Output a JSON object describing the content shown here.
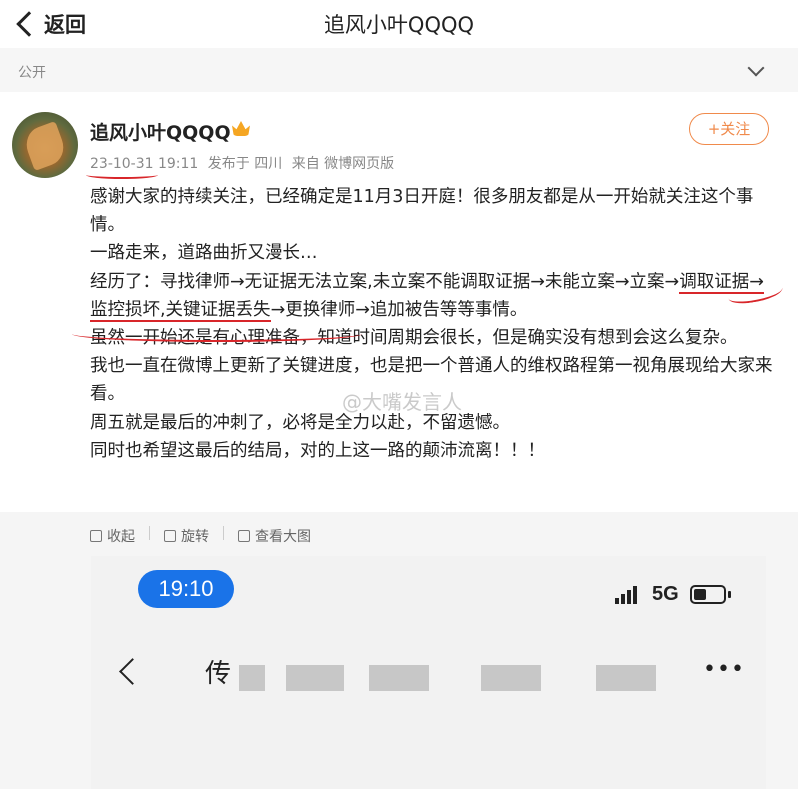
{
  "header": {
    "back_label": "返回",
    "title": "追风小叶QQQQ"
  },
  "privacy": {
    "label": "公开"
  },
  "post": {
    "author": "追风小叶QQQQ",
    "follow_label": "+关注",
    "time": "23-10-31 19:11",
    "location": "发布于 四川",
    "source": "来自 微博网页版",
    "lines": [
      "感谢大家的持续关注，已经确定是11月3日开庭！很多朋友都是从一开始就关注这个事情。",
      "一路走来，道路曲折又漫长…",
      "经历了：寻找律师→无证据无法立案,未立案不能调取证据→未能立案→立案→",
      "调取证据→监控损坏,关键证据丢失",
      "→更换律师→追加被告等等事情。",
      "虽然一开始还是有心理准备，知道时间周期会很长，但是确实没有想到会这么复杂。",
      "我也一直在微博上更新了关键进度，也是把一个普通人的维权路程第一视角展现给大家来看。",
      "周五就是最后的冲刺了，必将是全力以赴，不留遗憾。",
      "同时也希望这最后的结局，对的上这一路的颠沛流离！！！"
    ]
  },
  "image_tools": {
    "collapse": "收起",
    "rotate": "旋转",
    "view_large": "查看大图"
  },
  "screenshot": {
    "time": "19:10",
    "network": "5G",
    "chat_title_char": "传",
    "more": "•••"
  },
  "watermark": "@大嘴发言人",
  "colors": {
    "accent": "#f08a4b",
    "annotation_red": "#d8262a",
    "time_pill": "#1a73e8"
  }
}
